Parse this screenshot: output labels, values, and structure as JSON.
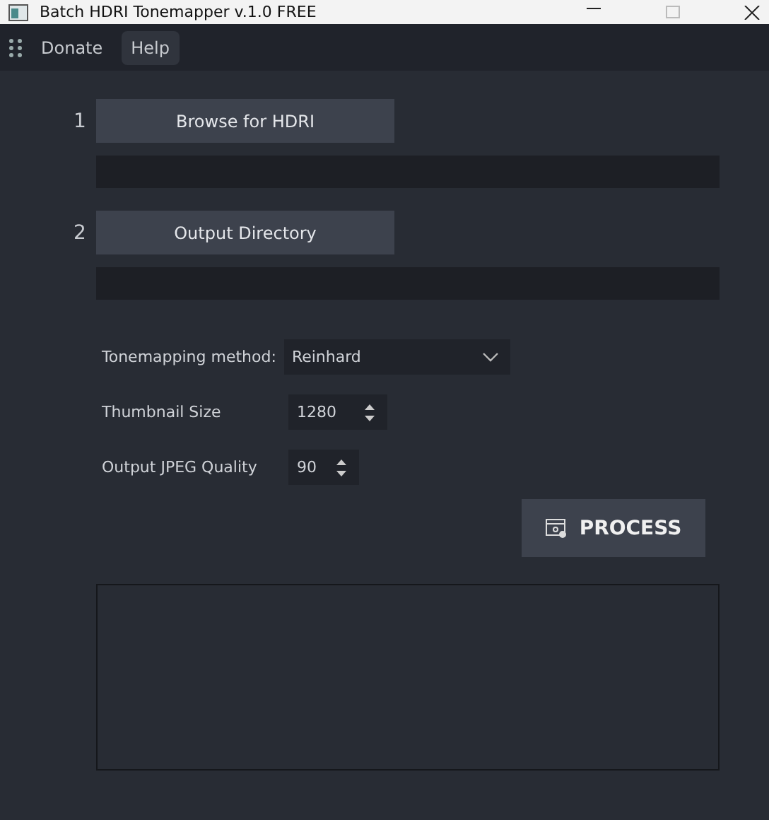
{
  "window": {
    "title": "Batch HDRI Tonemapper v.1.0 FREE"
  },
  "menu": [
    {
      "label": "Donate",
      "selected": false
    },
    {
      "label": "Help",
      "selected": true
    }
  ],
  "steps": [
    {
      "number": "1",
      "button": "Browse for HDRI"
    },
    {
      "number": "2",
      "button": "Output Directory"
    }
  ],
  "settings": {
    "method_label": "Tonemapping method:",
    "method": "Reinhard",
    "thumb_label": "Thumbnail Size",
    "thumb": "1280",
    "quality_label": "Output JPEG Quality",
    "quality": "90"
  },
  "process_button": "PROCESS"
}
